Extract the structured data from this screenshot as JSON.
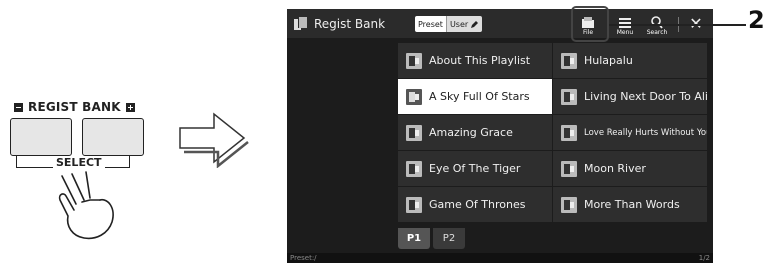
{
  "panel": {
    "regist_bank_label": "REGIST BANK",
    "select_label": "SELECT"
  },
  "screen": {
    "title": "Regist Bank",
    "toggle": {
      "preset": "Preset",
      "user": "User"
    },
    "toolbar": {
      "file": "File",
      "menu": "Menu",
      "search": "Search",
      "close": "✕"
    },
    "songs": [
      {
        "left": "About This Playlist",
        "right": "Hulapalu"
      },
      {
        "left": "A Sky Full Of Stars",
        "right": "Living Next Door To Alice"
      },
      {
        "left": "Amazing Grace",
        "right": "Love Really Hurts Without You"
      },
      {
        "left": "Eye Of The Tiger",
        "right": "Moon River"
      },
      {
        "left": "Game Of Thrones",
        "right": "More Than Words"
      }
    ],
    "selected_song": "A Sky Full Of Stars",
    "pages": [
      "P1",
      "P2"
    ],
    "active_page": "P1",
    "status_left": "Preset:/",
    "status_right": "1/2"
  },
  "callout": {
    "number": "2"
  }
}
